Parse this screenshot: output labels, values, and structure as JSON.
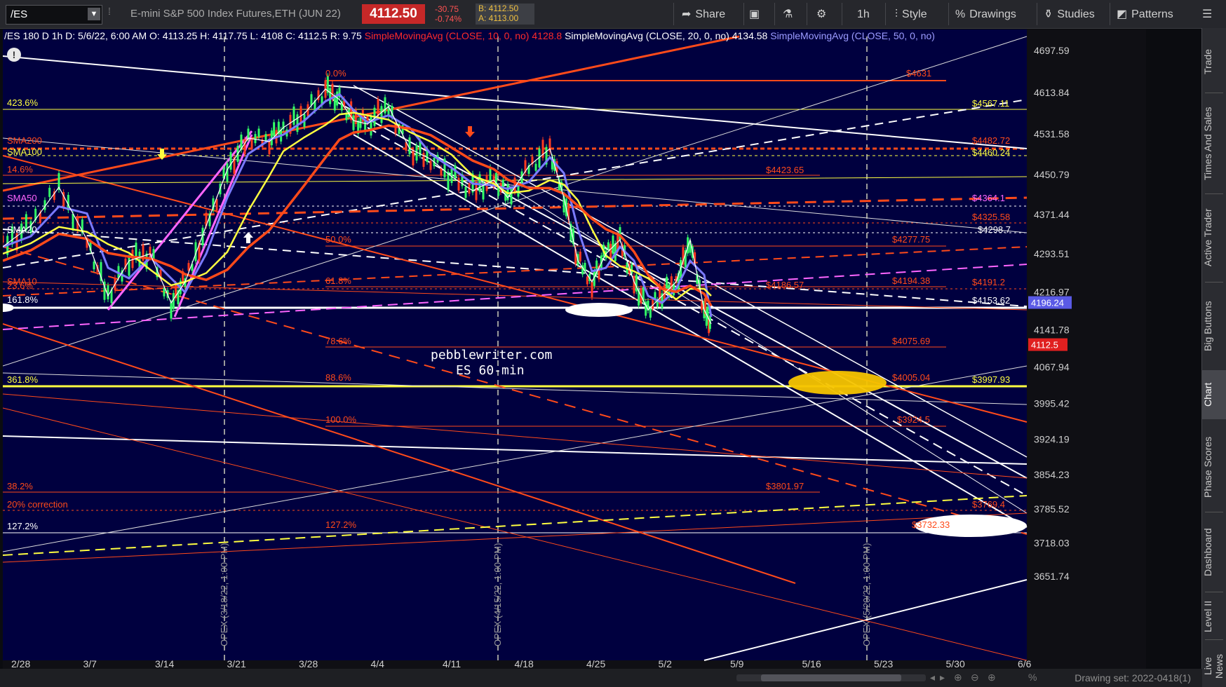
{
  "toolbar": {
    "symbol": "/ES",
    "description": "E-mini S&P 500 Index Futures,ETH (JUN 22)",
    "last": "4112.50",
    "net_change": "-30.75",
    "pct_change": "-0.74%",
    "bid": "B: 4112.50",
    "ask": "A: 4113.00",
    "share": "Share",
    "timeframe": "1h",
    "style": "Style",
    "drawings": "Drawings",
    "studies": "Studies",
    "patterns": "Patterns"
  },
  "chart_header": {
    "title": "/ES 180 D 1h",
    "date": "D: 5/6/22, 6:00 AM",
    "open": "O: 4113.25",
    "high": "H: 4117.75",
    "low": "L: 4108",
    "close": "C: 4112.5",
    "range": "R: 9.75",
    "sma10": "SimpleMovingAvg (CLOSE, 10, 0, no)",
    "sma10_val": "4128.8",
    "sma20": "SimpleMovingAvg (CLOSE, 20, 0, no)",
    "sma20_val": "4134.58",
    "sma50": "SimpleMovingAvg (CLOSE, 50, 0, no)"
  },
  "price_axis": [
    "4697.59",
    "4613.84",
    "4531.58",
    "4450.79",
    "4371.44",
    "4293.51",
    "4216.97",
    "4141.78",
    "4067.94",
    "3995.42",
    "3924.19",
    "3854.23",
    "3785.52",
    "3718.03",
    "3651.74"
  ],
  "price_tags": {
    "sma50_tag": "4196.24",
    "last_tag": "4112.5"
  },
  "date_axis": [
    "2/28",
    "3/7",
    "3/14",
    "3/21",
    "3/28",
    "4/4",
    "4/11",
    "4/18",
    "4/25",
    "5/2",
    "5/9",
    "5/16",
    "5/23",
    "5/30",
    "6/6"
  ],
  "opex_labels": [
    "OPEX (3/18/22, 1:00 PM)",
    "OPEX (4/15/22, 1:00 PM)",
    "OPEX (5/20/22, 1:00 PM)"
  ],
  "left_labels": [
    "423.6%",
    "SMA200",
    "SMA100",
    "14.6%",
    "SMA50",
    "SMA20",
    "23.6%",
    "SMA10",
    "161.8%",
    "361.8%",
    "38.2%",
    "20% correction",
    "127.2%"
  ],
  "fib_labels": [
    "0.0%",
    "50.0%",
    "61.8%",
    "78.6%",
    "88.6%",
    "100.0%",
    "127.2%"
  ],
  "level_labels": [
    "$4631",
    "$4567.11",
    "$4482.72",
    "$4460.24",
    "$4423.65",
    "$4364.1",
    "$4325.58",
    "$4298.7",
    "$4277.75",
    "$4194.38",
    "$4191.2",
    "$4186.57",
    "$4153.62",
    "$4075.69",
    "$4005.04",
    "$3997.93",
    "$3924.5",
    "$3801.97",
    "$3769.4",
    "$3732.33"
  ],
  "watermark": {
    "line1": "pebblewriter.com",
    "line2": "ES 60-min"
  },
  "side_tabs": [
    "Trade",
    "Times And Sales",
    "Active Trader",
    "Big Buttons",
    "Chart",
    "Phase Scores",
    "Dashboard",
    "Level II",
    "Live News"
  ],
  "drawing_set": "Drawing set: 2022-0418(1)",
  "colors": {
    "background": "#00003f",
    "up": "#ff3b1f",
    "sma_yellow": "#ffff40",
    "sma_blue": "#7a7aff",
    "sma_pink": "#ff66ff"
  }
}
